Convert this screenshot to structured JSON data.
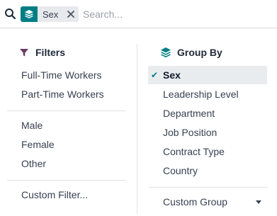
{
  "search": {
    "icon": "search-icon",
    "facet": {
      "icon": "layers-icon",
      "value": "Sex",
      "remove_icon": "close-icon"
    },
    "placeholder": "Search..."
  },
  "filters": {
    "title": "Filters",
    "icon": "funnel-icon",
    "icon_color": "#5b3a5a",
    "group1": [
      "Full-Time Workers",
      "Part-Time Workers"
    ],
    "group2": [
      "Male",
      "Female",
      "Other"
    ],
    "custom": "Custom Filter..."
  },
  "group_by": {
    "title": "Group By",
    "icon": "layers-icon",
    "icon_color": "#017e84",
    "items": [
      {
        "label": "Sex",
        "selected": true
      },
      {
        "label": "Leadership Level",
        "selected": false
      },
      {
        "label": "Department",
        "selected": false
      },
      {
        "label": "Job Position",
        "selected": false
      },
      {
        "label": "Contract Type",
        "selected": false
      },
      {
        "label": "Country",
        "selected": false
      }
    ],
    "custom": "Custom Group"
  },
  "colors": {
    "accent": "#017e84",
    "facet_bg": "#e7e9ed",
    "selected_bg": "#e9ecef"
  }
}
